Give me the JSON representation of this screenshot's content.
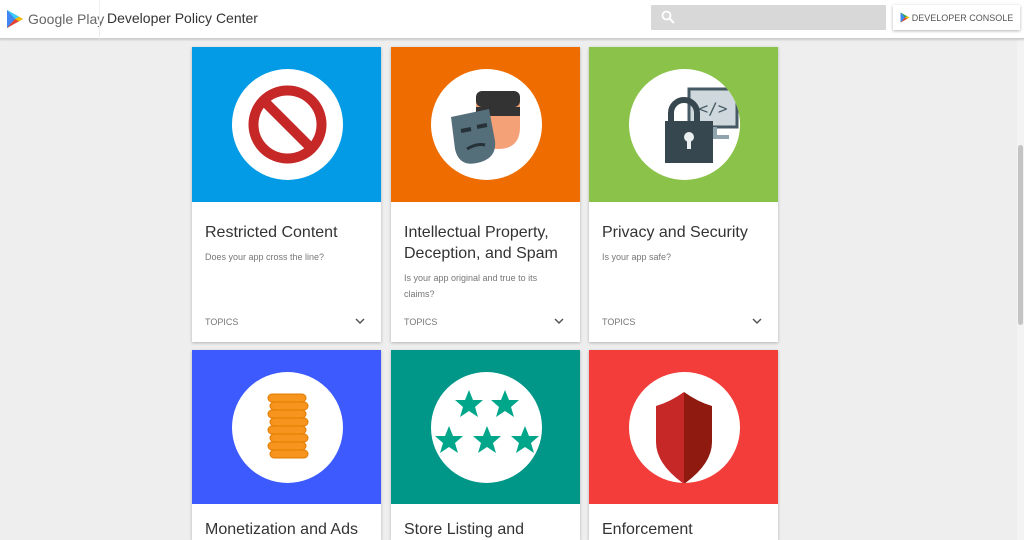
{
  "header": {
    "logo_text": "Google Play",
    "title": "Developer Policy Center",
    "search_placeholder": "",
    "console_label": "DEVELOPER CONSOLE"
  },
  "colors": {
    "blue": "#039be5",
    "orange": "#ef6c00",
    "green": "#8bc34a",
    "indigo": "#3d5afe",
    "teal": "#009688",
    "red": "#f23d3a"
  },
  "cards": [
    {
      "title": "Restricted Content",
      "desc": "Does your app cross the line?",
      "topics": "TOPICS",
      "icon": "prohibited-icon"
    },
    {
      "title": "Intellectual Property, Deception, and Spam",
      "desc": "Is your app original and true to its claims?",
      "topics": "TOPICS",
      "icon": "masks-icon"
    },
    {
      "title": "Privacy and Security",
      "desc": "Is your app safe?",
      "topics": "TOPICS",
      "icon": "lock-monitor-icon"
    },
    {
      "title": "Monetization and Ads",
      "icon": "coins-icon"
    },
    {
      "title": "Store Listing and",
      "icon": "stars-icon"
    },
    {
      "title": "Enforcement",
      "icon": "shield-icon"
    }
  ]
}
